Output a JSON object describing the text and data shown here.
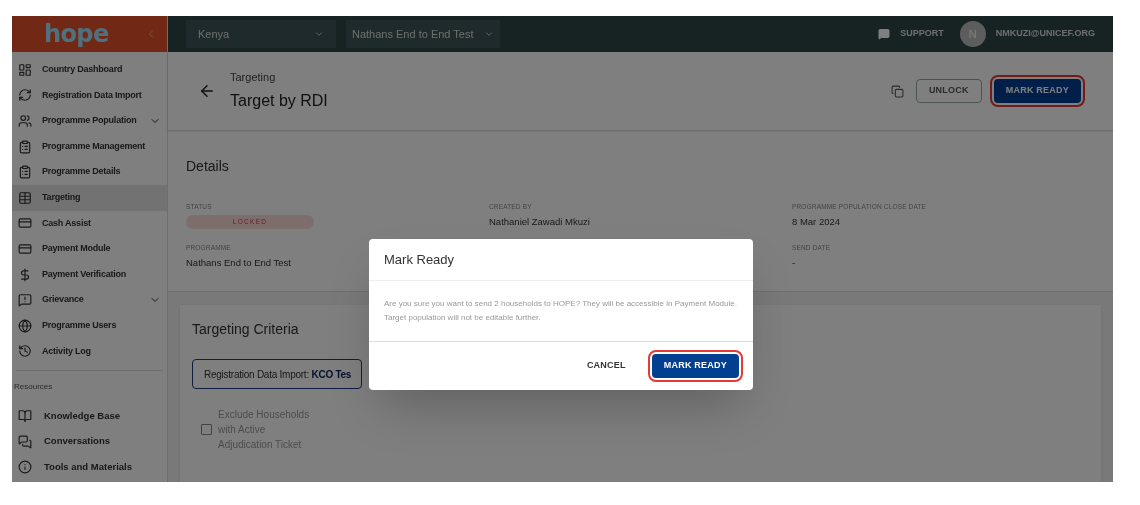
{
  "logo": "hope",
  "sidebar": {
    "items": [
      {
        "label": "Country Dashboard",
        "selected": false,
        "has_submenu": false
      },
      {
        "label": "Registration Data Import",
        "selected": false,
        "has_submenu": false
      },
      {
        "label": "Programme Population",
        "selected": false,
        "has_submenu": true
      },
      {
        "label": "Programme Management",
        "selected": false,
        "has_submenu": false
      },
      {
        "label": "Programme Details",
        "selected": false,
        "has_submenu": false
      },
      {
        "label": "Targeting",
        "selected": true,
        "has_submenu": false
      },
      {
        "label": "Cash Assist",
        "selected": false,
        "has_submenu": false
      },
      {
        "label": "Payment Module",
        "selected": false,
        "has_submenu": false
      },
      {
        "label": "Payment Verification",
        "selected": false,
        "has_submenu": false
      },
      {
        "label": "Grievance",
        "selected": false,
        "has_submenu": true
      },
      {
        "label": "Programme Users",
        "selected": false,
        "has_submenu": false
      },
      {
        "label": "Activity Log",
        "selected": false,
        "has_submenu": false
      }
    ],
    "resources_label": "Resources",
    "resources": [
      {
        "label": "Knowledge Base"
      },
      {
        "label": "Conversations"
      },
      {
        "label": "Tools and Materials"
      }
    ]
  },
  "top_bar": {
    "country": "Kenya",
    "programme": "Nathans End to End Test",
    "support": "SUPPORT",
    "avatar": "N",
    "email": "NMKUZI@UNICEF.ORG"
  },
  "header": {
    "breadcrumb": "Targeting",
    "title": "Target by RDI",
    "buttons": [
      {
        "label": "UNLOCK",
        "kind": "outlined",
        "highlighted": false
      },
      {
        "label": "MARK READY",
        "kind": "filled",
        "highlighted": true
      }
    ]
  },
  "details": {
    "title": "Details",
    "columns": [
      [
        {
          "label": "STATUS",
          "value": "LOCKED",
          "kind": "badge"
        },
        {
          "label": "PROGRAMME",
          "value": "Nathans End to End Test",
          "kind": "text"
        }
      ],
      [
        {
          "label": "CREATED BY",
          "value": "Nathaniel Zawadi Mkuzi",
          "kind": "text"
        }
      ],
      [
        {
          "label": "PROGRAMME POPULATION CLOSE DATE",
          "value": "8 Mar 2024",
          "kind": "text"
        },
        {
          "label": "SEND DATE",
          "value": "-",
          "kind": "text"
        }
      ]
    ]
  },
  "targeting_criteria": {
    "title": "Targeting Criteria",
    "criterion": "Registration Data Import: **KCO Tes**",
    "exclude_checkbox": {
      "label": "Exclude Households with Active Adjudication Ticket",
      "checked": false
    }
  },
  "dialog": {
    "title": "Mark Ready",
    "message": "Are you sure you want to send 2 households to HOPE? They will be accessible in Payment Module. Target population will not be editable further.",
    "buttons": [
      {
        "label": "CANCEL",
        "kind": "text",
        "highlighted": false
      },
      {
        "label": "MARK READY",
        "kind": "filled",
        "highlighted": true
      }
    ]
  }
}
